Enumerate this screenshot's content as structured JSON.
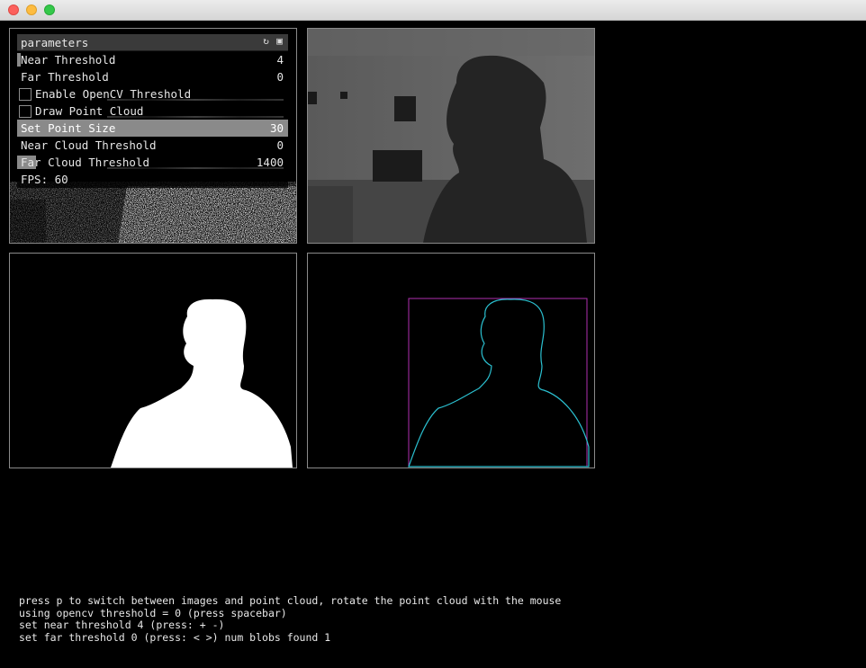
{
  "window": {
    "controls": [
      "close",
      "minimize",
      "zoom"
    ]
  },
  "gui": {
    "title": "parameters",
    "header_icons": [
      "reload-icon",
      "save-icon"
    ],
    "sliders": {
      "near_threshold": {
        "label": "Near Threshold",
        "value": "4",
        "fill": 0.016
      },
      "far_threshold": {
        "label": "Far Threshold",
        "value": "0",
        "fill": 0
      },
      "set_point_size": {
        "label": "Set Point Size",
        "value": "30",
        "fill": 1.0
      },
      "near_cloud": {
        "label": "Near Cloud Threshold",
        "value": "0",
        "fill": 0
      },
      "far_cloud": {
        "label": "Far Cloud Threshold",
        "value": "1400",
        "fill": 0.07
      }
    },
    "toggles": {
      "opencv": {
        "label": "Enable OpenCV Threshold",
        "checked": false
      },
      "point_cloud": {
        "label": "Draw Point Cloud",
        "checked": false
      }
    },
    "fps": "FPS: 60"
  },
  "colors": {
    "contour": "#2bc0d0",
    "bounding_box": "#b02fb0"
  },
  "info": {
    "line1": "press p to switch between images and point cloud, rotate the point cloud with the mouse",
    "line2": "using opencv threshold = 0 (press spacebar)",
    "line3": "set near threshold 4 (press: + -)",
    "line4": "set far threshold 0 (press: < >) num blobs found 1"
  }
}
